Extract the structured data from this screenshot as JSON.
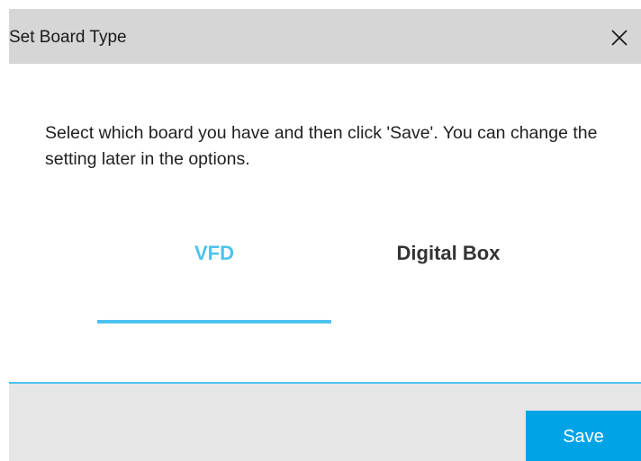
{
  "dialog": {
    "title": "Set Board Type",
    "close_icon": "close-icon",
    "message": "Select which board you have and then click 'Save'. You can change the setting later in the options.",
    "tabs": [
      {
        "label": "VFD",
        "selected": true
      },
      {
        "label": "Digital Box",
        "selected": false
      }
    ],
    "save_label": "Save"
  },
  "colors": {
    "accent": "#4cc2ee",
    "save_button": "#00a3e6",
    "titlebar": "#d6d6d6",
    "footer": "#e6e6e6"
  }
}
